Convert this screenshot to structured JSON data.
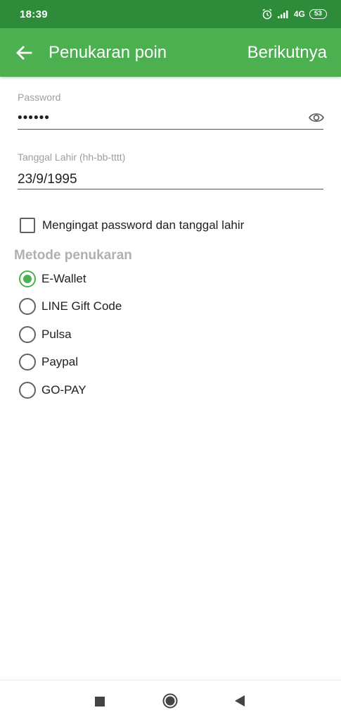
{
  "status_bar": {
    "time": "18:39",
    "network": "4G",
    "battery": "53"
  },
  "app_bar": {
    "title": "Penukaran poin",
    "next_label": "Berikutnya",
    "color": "#4caf50"
  },
  "form": {
    "password": {
      "label": "Password",
      "value": "••••••"
    },
    "birthdate": {
      "label": "Tanggal Lahir (hh-bb-tttt)",
      "value": "23/9/1995"
    },
    "remember": {
      "label": "Mengingat password dan tanggal lahir",
      "checked": false
    }
  },
  "method": {
    "title": "Metode penukaran",
    "selected": "E-Wallet",
    "options": [
      "E-Wallet",
      "LINE Gift Code",
      "Pulsa",
      "Paypal",
      "GO-PAY"
    ]
  },
  "icons": {
    "back": "arrow-left",
    "eye": "eye",
    "alarm": "alarm-clock",
    "signal": "signal-bars",
    "nav_recent": "square",
    "nav_home": "circle",
    "nav_back": "triangle-left"
  }
}
